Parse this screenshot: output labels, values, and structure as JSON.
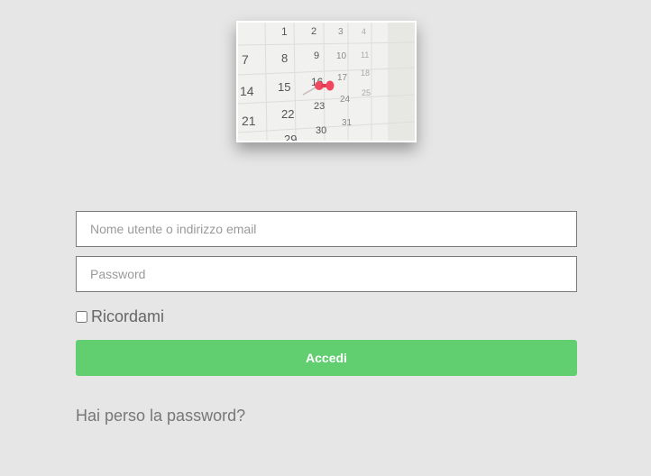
{
  "logo": {
    "icon": "calendar-with-pin-icon",
    "calendar_numbers": [
      "1",
      "2",
      "3",
      "4",
      "7",
      "8",
      "9",
      "10",
      "11",
      "14",
      "15",
      "16",
      "17",
      "18",
      "21",
      "22",
      "23",
      "24",
      "25",
      "29",
      "30",
      "31"
    ]
  },
  "login_form": {
    "username_placeholder": "Nome utente o indirizzo email",
    "password_placeholder": "Password",
    "remember_label": "Ricordami",
    "remember_checked": false,
    "submit_label": "Accedi",
    "lost_password_label": "Hai perso la password?"
  },
  "colors": {
    "background": "#e6e6e6",
    "button": "#61ce70",
    "pin": "#f0475f"
  }
}
